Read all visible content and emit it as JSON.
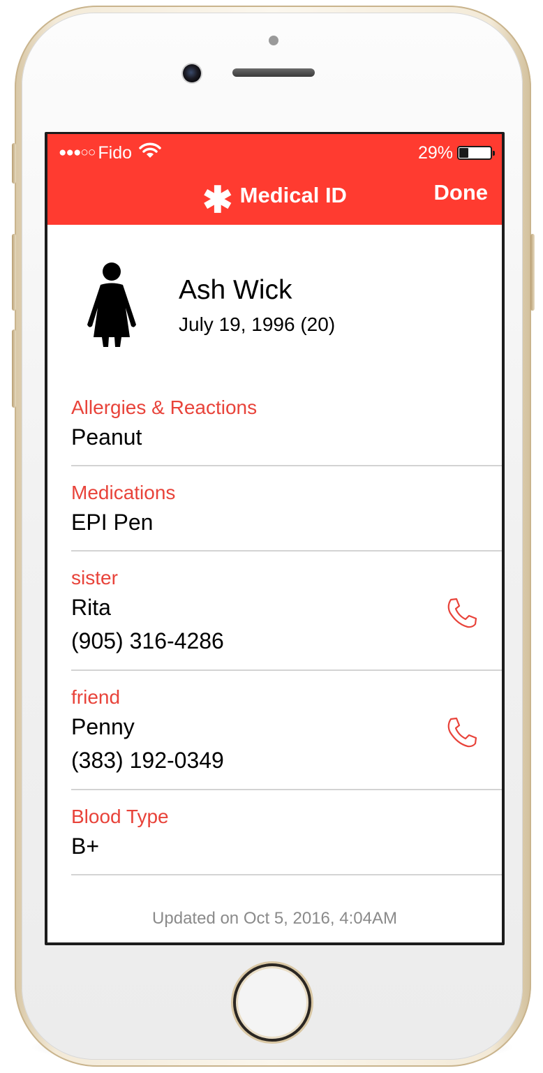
{
  "status_bar": {
    "signal": "●●●○○",
    "carrier": "Fido",
    "battery_percent": "29%",
    "battery_level": 0.29
  },
  "header": {
    "title": "Medical ID",
    "done_label": "Done",
    "background_color": "#ff3b30"
  },
  "profile": {
    "name": "Ash Wick",
    "dob": "July 19, 1996 (20)"
  },
  "sections": [
    {
      "label": "Allergies & Reactions",
      "values": [
        "Peanut"
      ]
    },
    {
      "label": "Medications",
      "values": [
        "EPI Pen"
      ]
    },
    {
      "label": "sister",
      "values": [
        "Rita",
        "(905) 316-4286"
      ]
    },
    {
      "label": "friend",
      "values": [
        "Penny",
        "(383) 192-0349"
      ]
    },
    {
      "label": "Blood Type",
      "values": [
        "B+"
      ]
    }
  ],
  "footer": "Updated on Oct 5, 2016, 4:04AM",
  "accent_color": "#e8433a"
}
